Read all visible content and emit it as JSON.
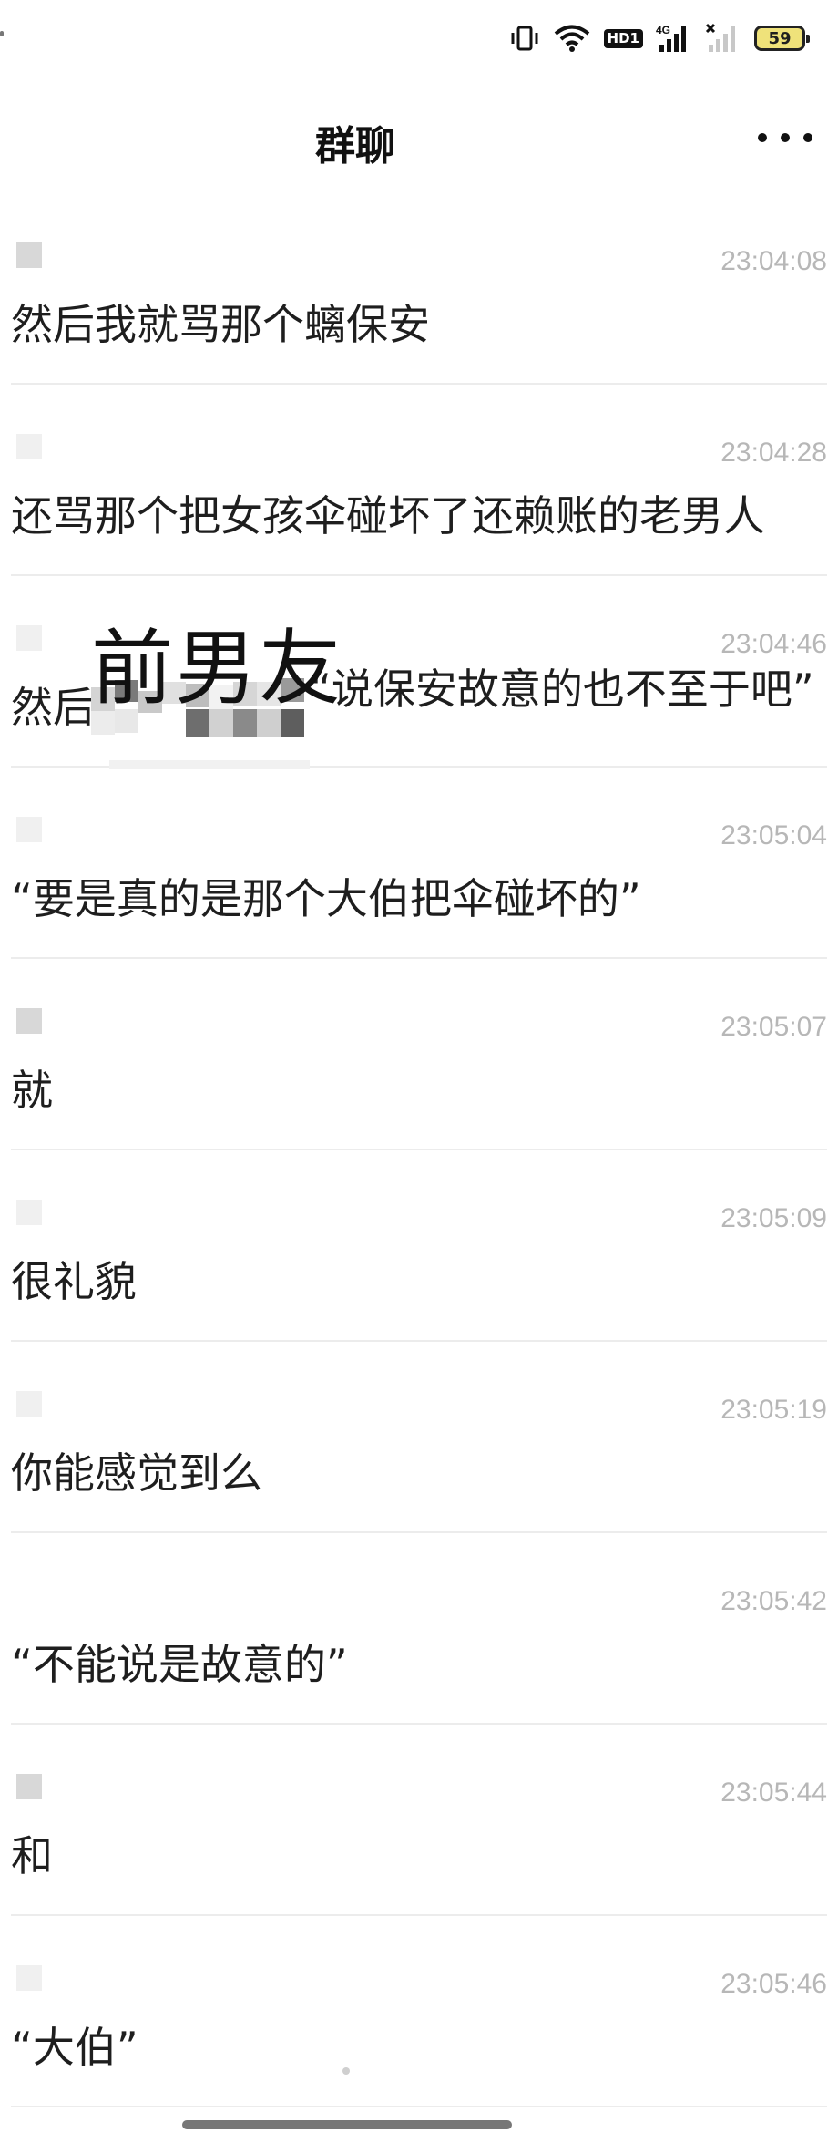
{
  "status_bar": {
    "icons": [
      "vibrate-icon",
      "wifi-icon",
      "hd-icon",
      "signal-4g-icon",
      "signal-no-sim-icon",
      "battery-icon"
    ],
    "hd_label": "HD1",
    "network_label": "4G",
    "battery_level": "59"
  },
  "nav": {
    "title": "群聊",
    "more_icon": "more-horizontal-icon"
  },
  "messages": [
    {
      "time": "23:04:08",
      "text": "然后我就骂那个螭保安"
    },
    {
      "time": "23:04:28",
      "text": "还骂那个把女孩伞碰坏了还赖账的老男人"
    },
    {
      "time": "23:04:46",
      "text_prefix": "然后",
      "text_suffix": "“说保安故意的也不至于吧”"
    },
    {
      "time": "23:05:04",
      "text": "“要是真的是那个大伯把伞碰坏的”"
    },
    {
      "time": "23:05:07",
      "text": "就"
    },
    {
      "time": "23:05:09",
      "text": "很礼貌"
    },
    {
      "time": "23:05:19",
      "text": "你能感觉到么"
    },
    {
      "time": "23:05:42",
      "text": "“不能说是故意的”"
    },
    {
      "time": "23:05:44",
      "text": "和"
    },
    {
      "time": "23:05:46",
      "text": "“大伯”"
    }
  ],
  "annotation": {
    "overlay_text": "前男友"
  }
}
